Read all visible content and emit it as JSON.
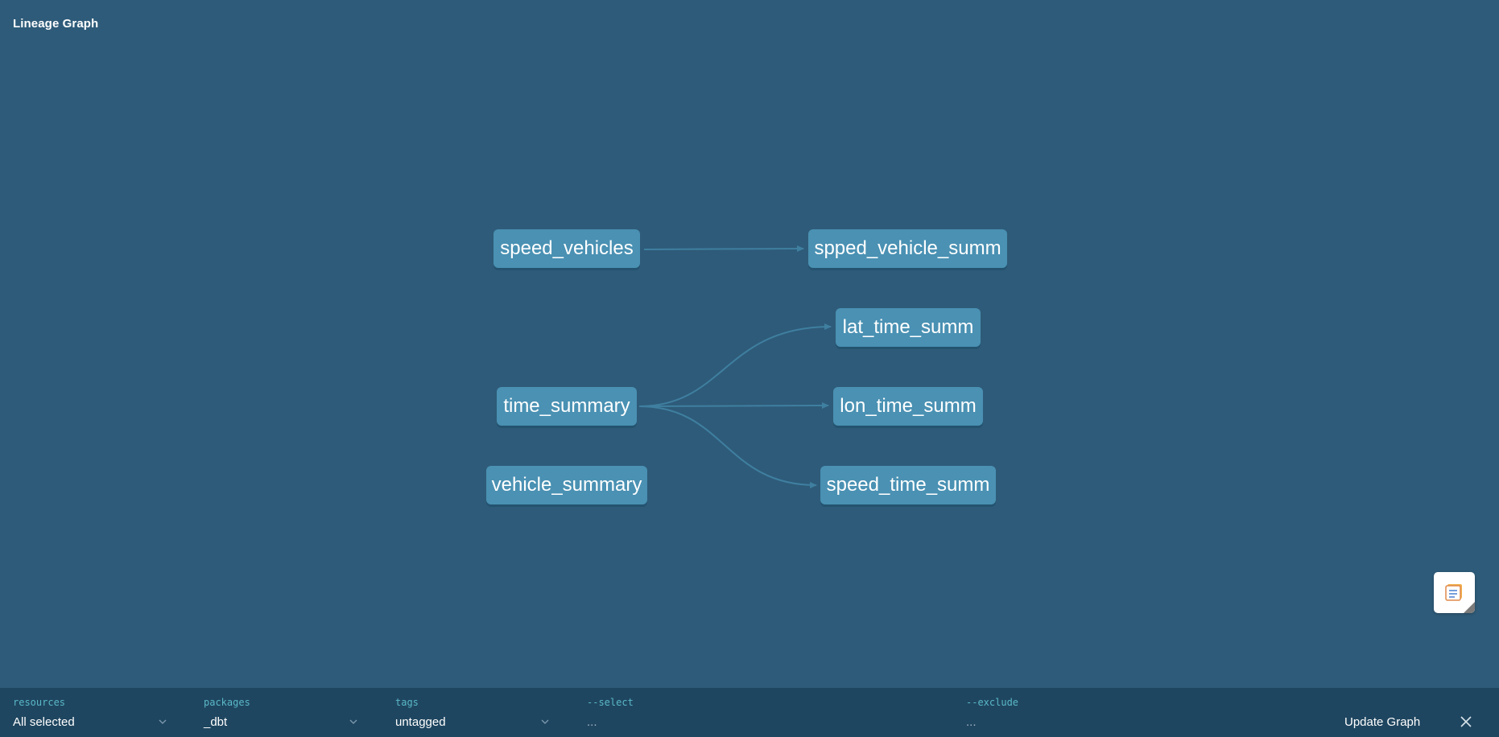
{
  "header": {
    "title": "Lineage Graph"
  },
  "graph": {
    "nodes": {
      "speed_vehicles": "speed_vehicles",
      "spped_vehicle_summ": "spped_vehicle_summ",
      "lat_time_summ": "lat_time_summ",
      "time_summary": "time_summary",
      "lon_time_summ": "lon_time_summ",
      "vehicle_summary": "vehicle_summary",
      "speed_time_summ": "speed_time_summ"
    },
    "edges": [
      {
        "from": "speed_vehicles",
        "to": "spped_vehicle_summ"
      },
      {
        "from": "time_summary",
        "to": "lat_time_summ"
      },
      {
        "from": "time_summary",
        "to": "lon_time_summ"
      },
      {
        "from": "time_summary",
        "to": "speed_time_summ"
      }
    ]
  },
  "legend": {
    "icon": "legend-icon"
  },
  "footer": {
    "resources": {
      "label": "resources",
      "value": "All selected"
    },
    "packages": {
      "label": "packages",
      "value": "_dbt"
    },
    "tags": {
      "label": "tags",
      "value": "untagged"
    },
    "select": {
      "label": "--select",
      "value": "..."
    },
    "exclude": {
      "label": "--exclude",
      "value": "..."
    },
    "update_label": "Update Graph",
    "close_icon": "close-icon"
  },
  "colors": {
    "background": "#2e5b79",
    "node": "#4a91b3",
    "edge": "#3f7fa0",
    "footer": "#1f4660",
    "label": "#5ab8c8"
  }
}
